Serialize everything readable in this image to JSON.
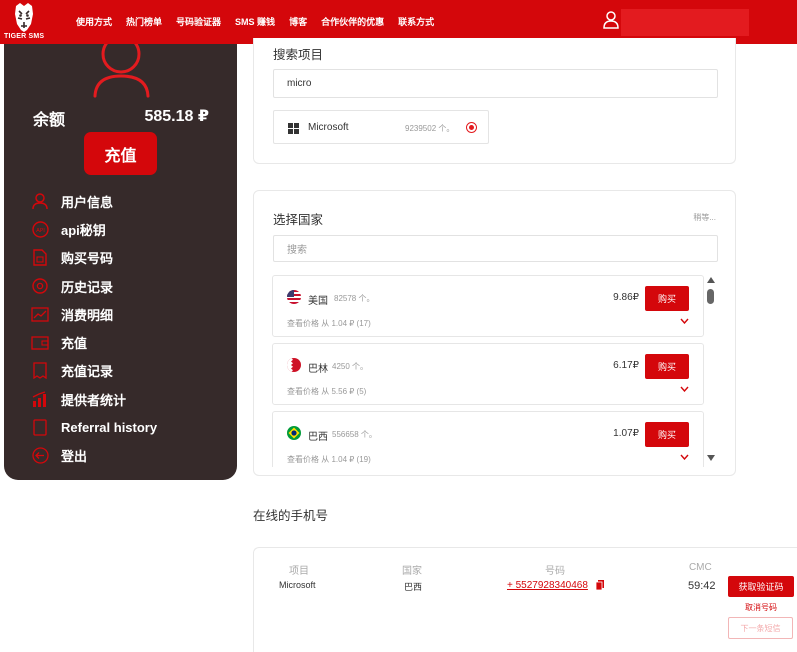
{
  "brand": {
    "logo_text": "TIGER SMS"
  },
  "nav": {
    "items": [
      {
        "label": "使用方式"
      },
      {
        "label": "热门榜单"
      },
      {
        "label": "号码验证器"
      },
      {
        "label": "SMS 赚钱"
      },
      {
        "label": "博客"
      },
      {
        "label": "合作伙伴的优惠"
      },
      {
        "label": "联系方式"
      }
    ]
  },
  "sidebar": {
    "balance_label": "余额",
    "balance_value": "585.18 ₽",
    "topup_label": "充值",
    "menu": [
      {
        "label": "用户信息",
        "icon": "user-icon"
      },
      {
        "label": "api秘钥",
        "icon": "api-icon"
      },
      {
        "label": "购买号码",
        "icon": "sim-card-icon"
      },
      {
        "label": "历史记录",
        "icon": "at-icon"
      },
      {
        "label": "消费明细",
        "icon": "chart-line-icon"
      },
      {
        "label": "充值",
        "icon": "wallet-icon"
      },
      {
        "label": "充值记录",
        "icon": "receipt-icon"
      },
      {
        "label": "提供者统计",
        "icon": "bar-chart-icon"
      },
      {
        "label": "Referral history",
        "icon": "document-icon"
      },
      {
        "label": "登出",
        "icon": "logout-icon"
      }
    ]
  },
  "search_section": {
    "title": "搜索项目",
    "query": "micro",
    "result": {
      "name": "Microsoft",
      "count": "9239502 个。",
      "selected": true
    }
  },
  "country_section": {
    "title": "选择国家",
    "sort_label": "稍等...",
    "search_placeholder": "搜索",
    "countries": [
      {
        "name": "美国",
        "count": "82578 个。",
        "price": "9.86₽",
        "buy_label": "购买",
        "price_from": "查看价格 从 1.04 ₽ (17)",
        "flag": "us-flag-icon"
      },
      {
        "name": "巴林",
        "count": "4250 个。",
        "price": "6.17₽",
        "buy_label": "购买",
        "price_from": "查看价格 从 5.56 ₽ (5)",
        "flag": "bahrain-flag-icon"
      },
      {
        "name": "巴西",
        "count": "556658 个。",
        "price": "1.07₽",
        "buy_label": "购买",
        "price_from": "查看价格 从 1.04 ₽ (19)",
        "flag": "brazil-flag-icon"
      }
    ]
  },
  "online_section": {
    "title": "在线的手机号",
    "headers": {
      "service": "项目",
      "country": "国家",
      "number": "号码",
      "sms": "СМС"
    },
    "row": {
      "service": "Microsoft",
      "country": "巴西",
      "number": "+ 5527928340468",
      "timer": "59:42",
      "get_code_label": "获取验证码",
      "cancel_label": "取消号码",
      "next_label": "下一条短信"
    }
  },
  "colors": {
    "brand_red": "#d4070b",
    "sidebar_bg": "#362a2a"
  }
}
